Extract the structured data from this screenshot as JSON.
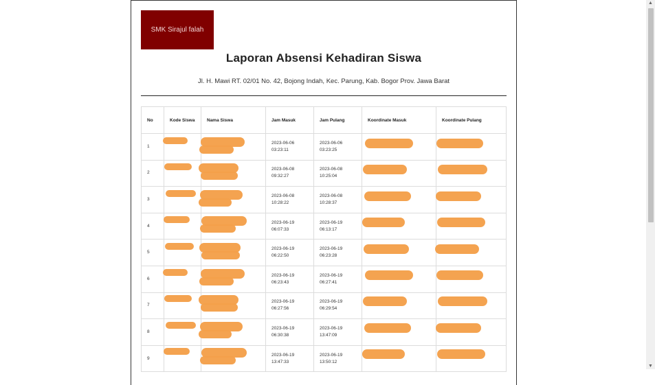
{
  "logo": {
    "text": "SMK Sirajul falah",
    "color": "#800000"
  },
  "report": {
    "title": "Laporan Absensi Kehadiran Siswa",
    "address": "Jl. H. Mawi RT. 02/01 No. 42, Bojong Indah, Kec. Parung, Kab. Bogor Prov. Jawa Barat"
  },
  "table": {
    "headers": {
      "no": "No",
      "kode": "Kode Siswa",
      "nama": "Nama Siswa",
      "jam_masuk": "Jam Masuk",
      "jam_pulang": "Jam Pulang",
      "koord_masuk": "Koordinate Masuk",
      "koord_pulang": "Koordinate Pulang"
    },
    "rows": [
      {
        "no": "1",
        "masuk_date": "2023-06-06",
        "masuk_time": "03:23:11",
        "pulang_date": "2023-06-06",
        "pulang_time": "03:23:25"
      },
      {
        "no": "2",
        "masuk_date": "2023-06-08",
        "masuk_time": "09:32:27",
        "pulang_date": "2023-06-08",
        "pulang_time": "10:25:04"
      },
      {
        "no": "3",
        "masuk_date": "2023-06-08",
        "masuk_time": "10:28:22",
        "pulang_date": "2023-06-08",
        "pulang_time": "10:28:37"
      },
      {
        "no": "4",
        "masuk_date": "2023-06-19",
        "masuk_time": "06:07:33",
        "pulang_date": "2023-06-19",
        "pulang_time": "06:13:17"
      },
      {
        "no": "5",
        "masuk_date": "2023-06-19",
        "masuk_time": "06:22:50",
        "pulang_date": "2023-06-19",
        "pulang_time": "06:23:28"
      },
      {
        "no": "6",
        "masuk_date": "2023-06-19",
        "masuk_time": "06:23:43",
        "pulang_date": "2023-06-19",
        "pulang_time": "06:27:41"
      },
      {
        "no": "7",
        "masuk_date": "2023-06-19",
        "masuk_time": "06:27:56",
        "pulang_date": "2023-06-19",
        "pulang_time": "06:29:54"
      },
      {
        "no": "8",
        "masuk_date": "2023-06-19",
        "masuk_time": "06:30:38",
        "pulang_date": "2023-06-19",
        "pulang_time": "13:47:09"
      },
      {
        "no": "9",
        "masuk_date": "2023-06-19",
        "masuk_time": "13:47:33",
        "pulang_date": "2023-06-19",
        "pulang_time": "13:50:12"
      }
    ]
  },
  "redaction": {
    "color": "#f4a04a"
  },
  "scrollbar": {
    "up_icon": "▲",
    "down_icon": "▼"
  }
}
